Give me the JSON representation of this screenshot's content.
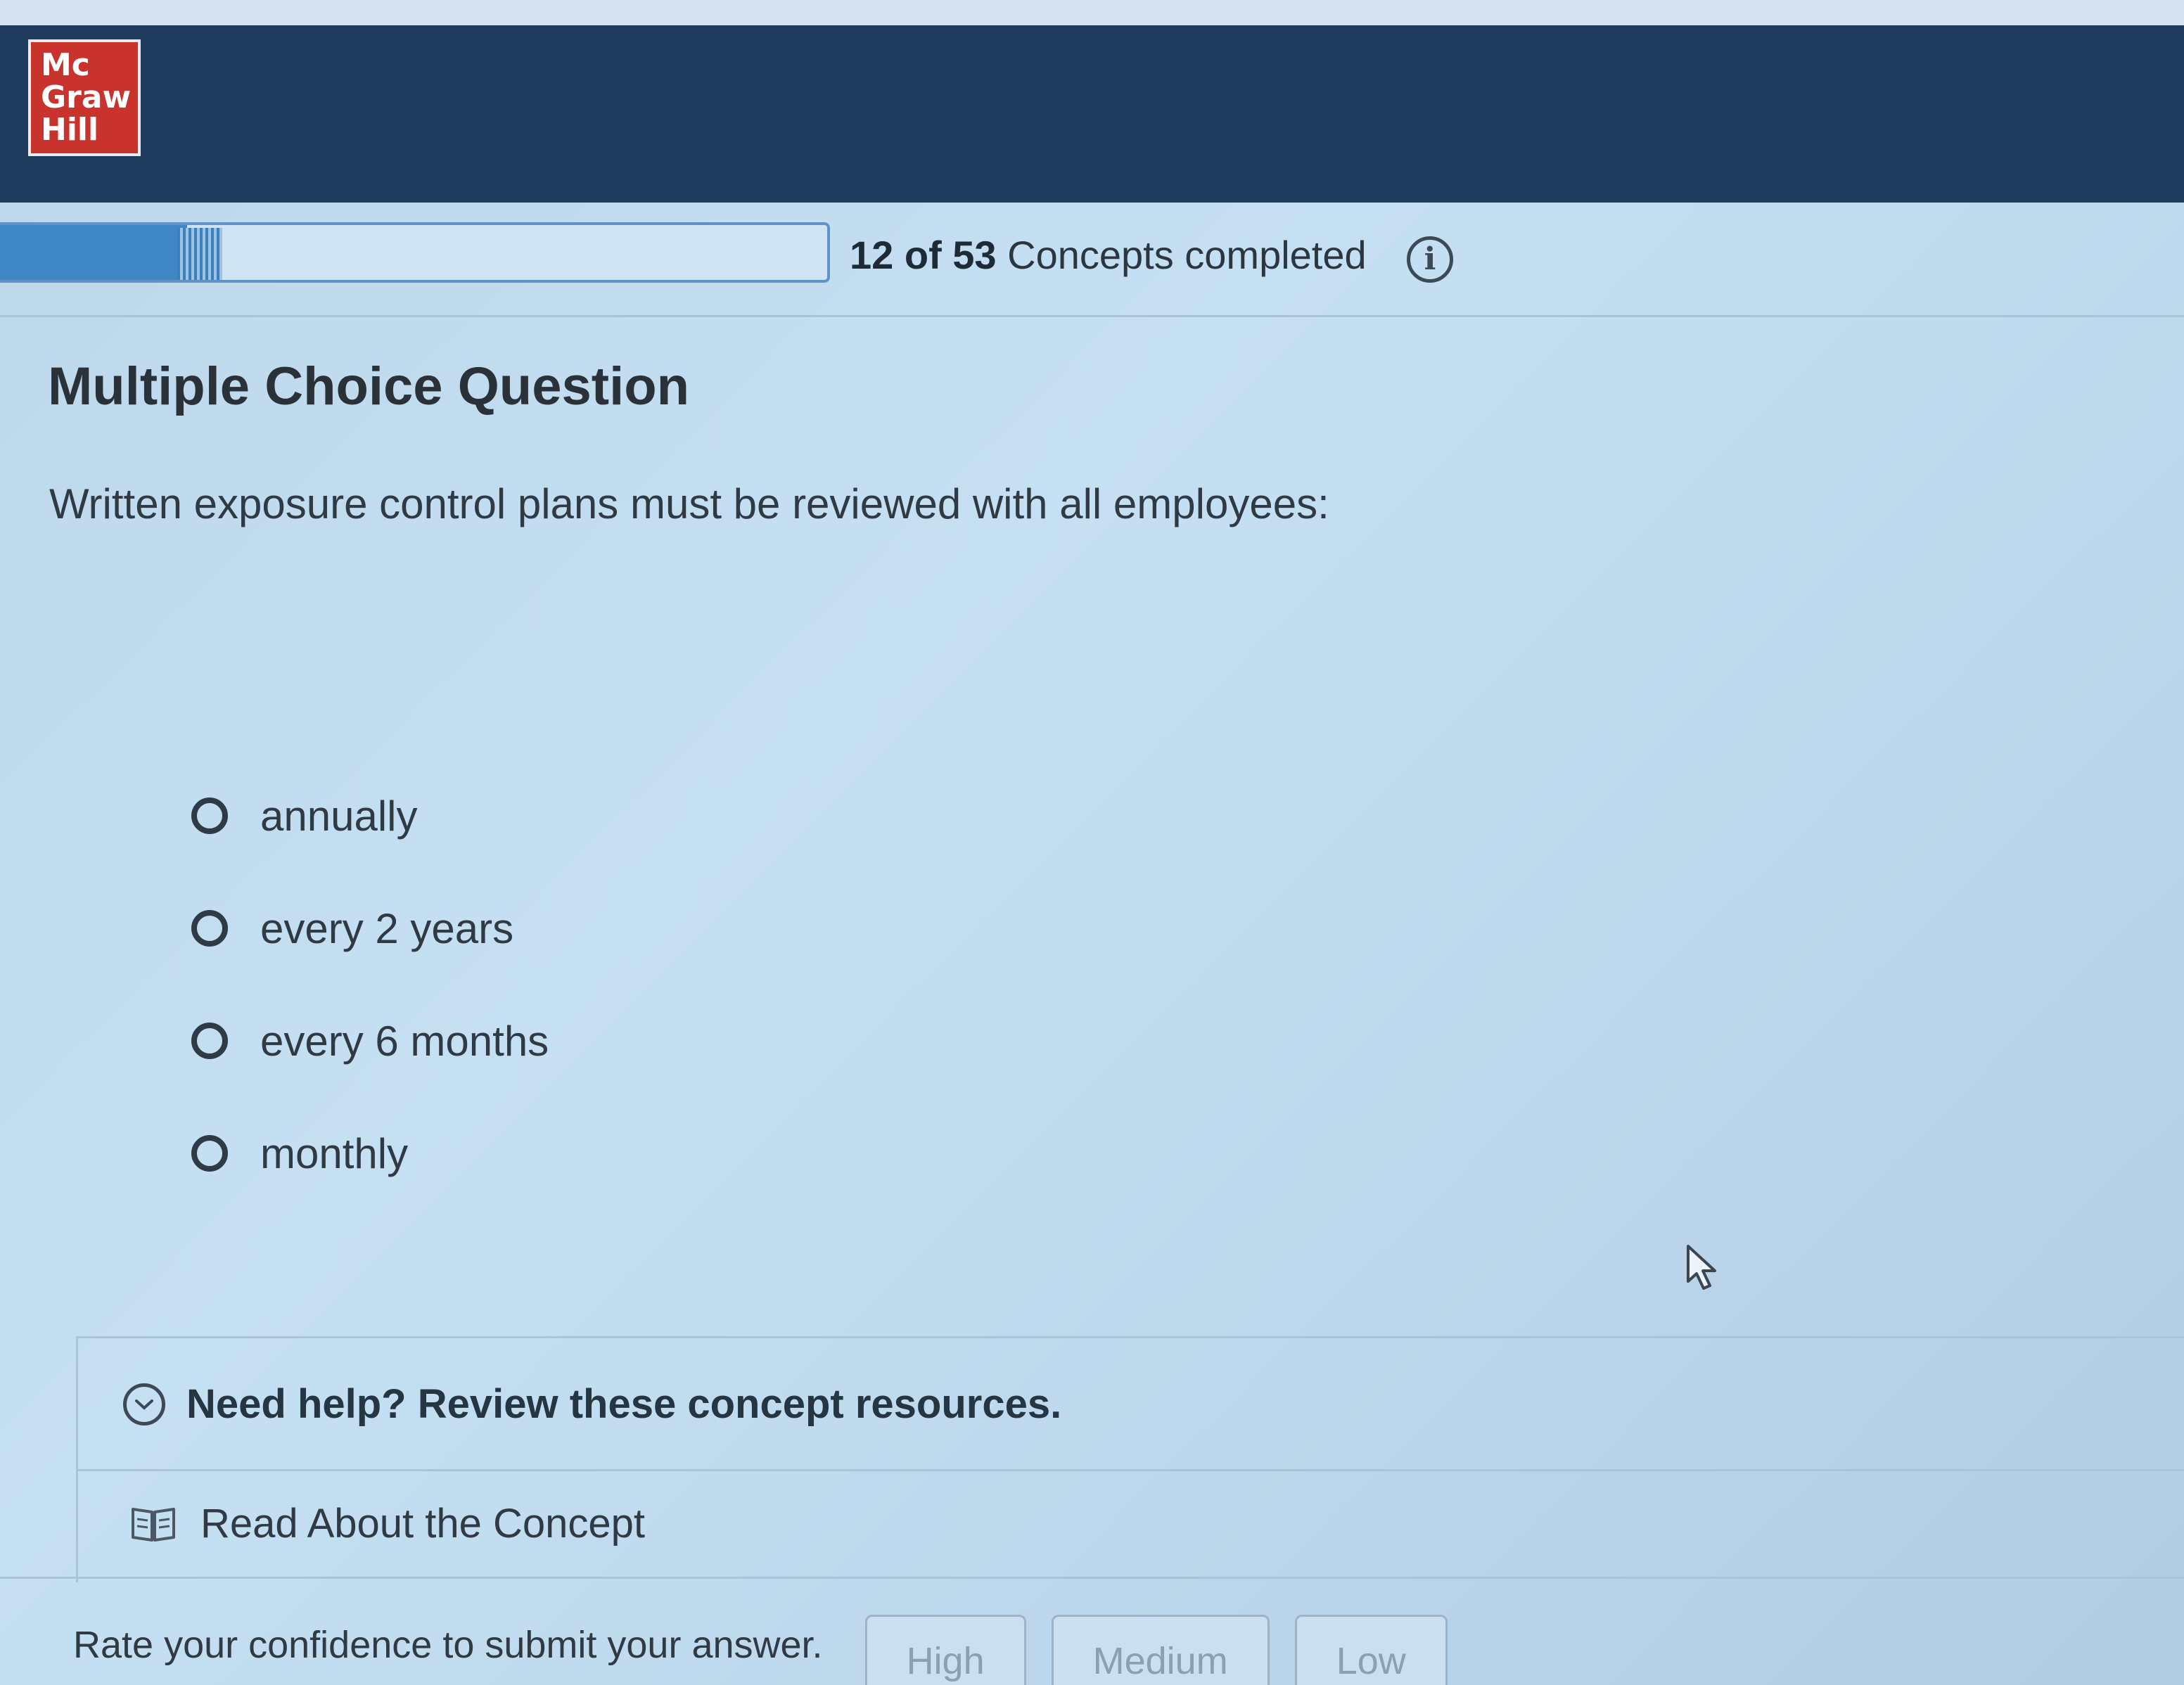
{
  "header": {
    "logo_lines": [
      "Mc",
      "Graw",
      "Hill"
    ]
  },
  "progress": {
    "completed": "12",
    "of_word": "of",
    "total": "53",
    "suffix": "Concepts completed",
    "fraction": 0.226
  },
  "question": {
    "title": "Multiple Choice Question",
    "prompt": "Written exposure control plans must be reviewed with all employees:",
    "options": [
      {
        "label": "annually"
      },
      {
        "label": "every 2 years"
      },
      {
        "label": "every 6 months"
      },
      {
        "label": "monthly"
      }
    ]
  },
  "help": {
    "header": "Need help? Review these concept resources.",
    "read_link": "Read About the Concept"
  },
  "confidence": {
    "prompt": "Rate your confidence to submit your answer.",
    "buttons": [
      "High",
      "Medium",
      "Low"
    ]
  },
  "colors": {
    "header_bg": "#1e3a5c",
    "logo_red": "#c8332d",
    "progress_fill": "#3f87c4"
  }
}
